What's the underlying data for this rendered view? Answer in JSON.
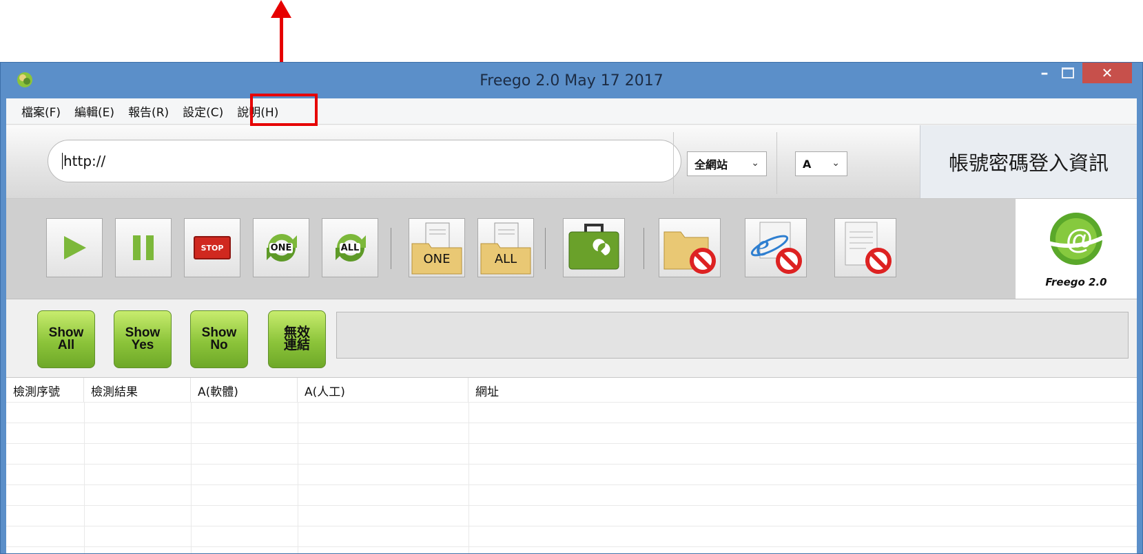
{
  "window": {
    "title": "Freego 2.0 May 17 2017"
  },
  "menu": [
    {
      "label": "檔案(F)"
    },
    {
      "label": "編輯(E)"
    },
    {
      "label": "報告(R)"
    },
    {
      "label": "設定(C)"
    },
    {
      "label": "說明(H)"
    }
  ],
  "urlbar": {
    "url_value": "http://",
    "scope_select": "全網站",
    "level_select": "A",
    "login_label": "帳號密碼登入資訊"
  },
  "toolbar": {
    "stop_label": "STOP",
    "check_one_label": "ONE",
    "check_all_label": "ALL",
    "folder_one_label": "ONE",
    "folder_all_label": "ALL",
    "logo_text": "Freego 2.0"
  },
  "filters": [
    {
      "line1": "Show",
      "line2": "All"
    },
    {
      "line1": "Show",
      "line2": "Yes"
    },
    {
      "line1": "Show",
      "line2": "No"
    },
    {
      "line1": "無效",
      "line2": "連結"
    }
  ],
  "table": {
    "columns": [
      "檢測序號",
      "檢測結果",
      "A(軟體)",
      "A(人工)",
      "網址"
    ]
  },
  "colors": {
    "accent": "#e60000",
    "titlebar": "#5b8fc9",
    "close": "#c7504b",
    "button_green": "#8cc43a"
  }
}
